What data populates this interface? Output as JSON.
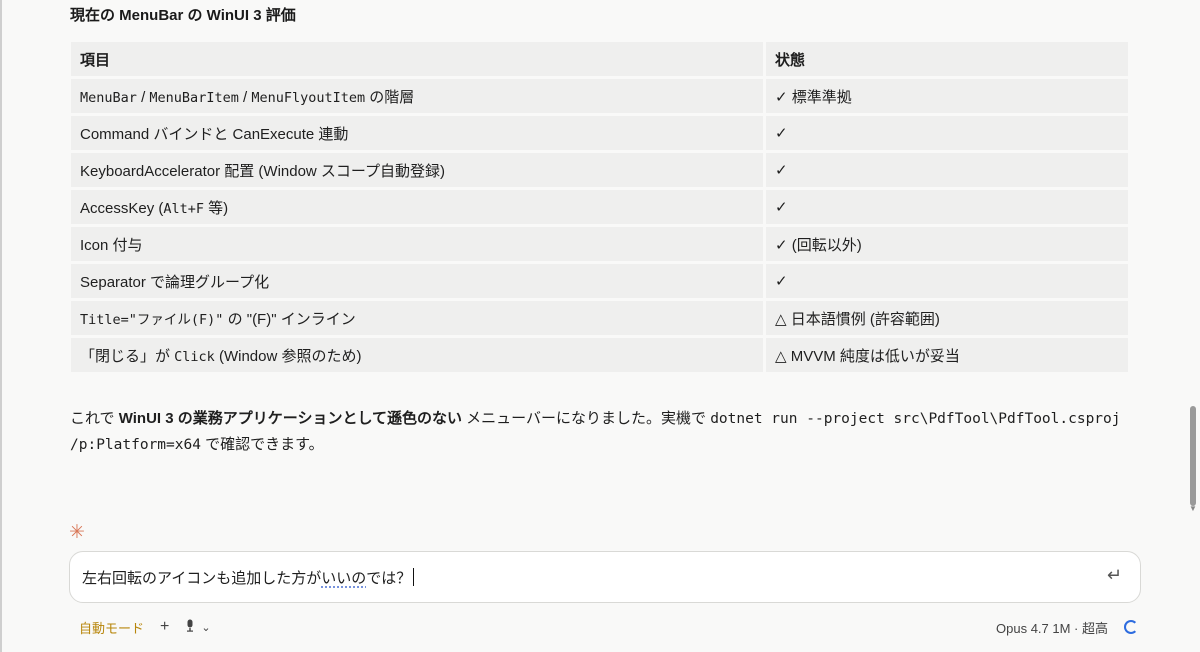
{
  "heading": "現在の MenuBar の WinUI 3 評価",
  "table": {
    "headers": [
      "項目",
      "状態"
    ],
    "rows": [
      {
        "item": [
          {
            "t": "MenuBar",
            "m": true
          },
          {
            "t": " / "
          },
          {
            "t": "MenuBarItem",
            "m": true
          },
          {
            "t": " / "
          },
          {
            "t": "MenuFlyoutItem",
            "m": true
          },
          {
            "t": " の階層"
          }
        ],
        "status": "✓ 標準準拠"
      },
      {
        "item": [
          {
            "t": "Command バインドと CanExecute 連動"
          }
        ],
        "status": "✓"
      },
      {
        "item": [
          {
            "t": "KeyboardAccelerator 配置 (Window スコープ自動登録)"
          }
        ],
        "status": "✓"
      },
      {
        "item": [
          {
            "t": "AccessKey ("
          },
          {
            "t": "Alt+F",
            "m": true
          },
          {
            "t": " 等)"
          }
        ],
        "status": "✓"
      },
      {
        "item": [
          {
            "t": "Icon 付与"
          }
        ],
        "status": "✓ (回転以外)"
      },
      {
        "item": [
          {
            "t": "Separator で論理グループ化"
          }
        ],
        "status": "✓"
      },
      {
        "item": [
          {
            "t": "Title=\"ファイル(F)\"",
            "m": true
          },
          {
            "t": " の \"(F)\" インライン"
          }
        ],
        "status": "△ 日本語慣例 (許容範囲)"
      },
      {
        "item": [
          {
            "t": "「閉じる」が "
          },
          {
            "t": "Click",
            "m": true
          },
          {
            "t": " (Window 参照のため)"
          }
        ],
        "status": "△ MVVM 純度は低いが妥当"
      }
    ]
  },
  "paragraph": [
    {
      "t": "これで "
    },
    {
      "t": "WinUI 3 の業務アプリケーションとして遜色のない",
      "b": true
    },
    {
      "t": " メニューバーになりました。実機で "
    },
    {
      "t": "dotnet run --project src\\PdfTool\\PdfTool.csproj /p:Platform=x64",
      "m": true
    },
    {
      "t": " で確認できます。"
    }
  ],
  "star_icon": "asterisk-icon",
  "input": {
    "before": "左右回転のアイコンも追加した方が",
    "underlined": "いいの",
    "after": "では？"
  },
  "toolbar": {
    "mode_label": "自動モード",
    "plus": "+",
    "mic_icon": "mic-icon",
    "chevron": "⌄"
  },
  "model_label": "Opus 4.7 1M · 超高",
  "colors": {
    "accent": "#d97757",
    "mode": "#b8860b",
    "spinner": "#2d6cdf"
  }
}
